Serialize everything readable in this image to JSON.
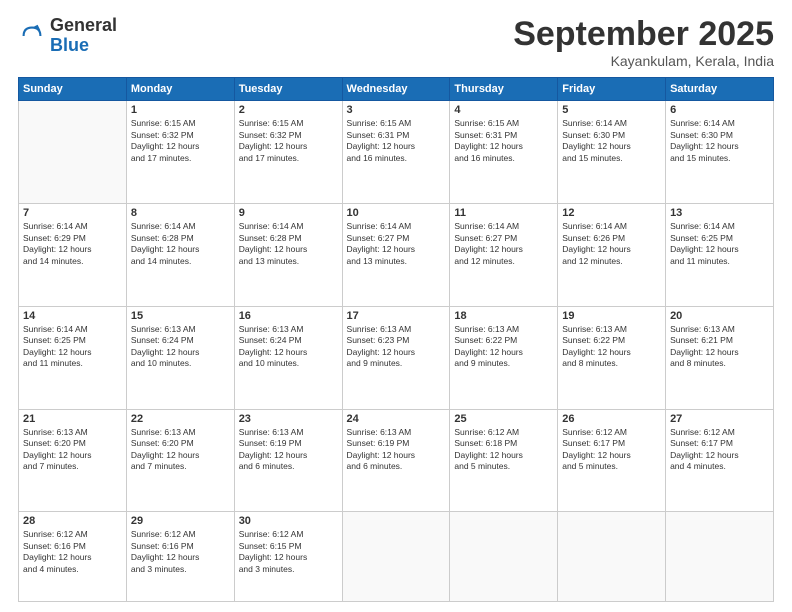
{
  "logo": {
    "general": "General",
    "blue": "Blue"
  },
  "header": {
    "month": "September 2025",
    "location": "Kayankulam, Kerala, India"
  },
  "weekdays": [
    "Sunday",
    "Monday",
    "Tuesday",
    "Wednesday",
    "Thursday",
    "Friday",
    "Saturday"
  ],
  "weeks": [
    [
      {
        "day": "",
        "info": ""
      },
      {
        "day": "1",
        "info": "Sunrise: 6:15 AM\nSunset: 6:32 PM\nDaylight: 12 hours\nand 17 minutes."
      },
      {
        "day": "2",
        "info": "Sunrise: 6:15 AM\nSunset: 6:32 PM\nDaylight: 12 hours\nand 17 minutes."
      },
      {
        "day": "3",
        "info": "Sunrise: 6:15 AM\nSunset: 6:31 PM\nDaylight: 12 hours\nand 16 minutes."
      },
      {
        "day": "4",
        "info": "Sunrise: 6:15 AM\nSunset: 6:31 PM\nDaylight: 12 hours\nand 16 minutes."
      },
      {
        "day": "5",
        "info": "Sunrise: 6:14 AM\nSunset: 6:30 PM\nDaylight: 12 hours\nand 15 minutes."
      },
      {
        "day": "6",
        "info": "Sunrise: 6:14 AM\nSunset: 6:30 PM\nDaylight: 12 hours\nand 15 minutes."
      }
    ],
    [
      {
        "day": "7",
        "info": "Sunrise: 6:14 AM\nSunset: 6:29 PM\nDaylight: 12 hours\nand 14 minutes."
      },
      {
        "day": "8",
        "info": "Sunrise: 6:14 AM\nSunset: 6:28 PM\nDaylight: 12 hours\nand 14 minutes."
      },
      {
        "day": "9",
        "info": "Sunrise: 6:14 AM\nSunset: 6:28 PM\nDaylight: 12 hours\nand 13 minutes."
      },
      {
        "day": "10",
        "info": "Sunrise: 6:14 AM\nSunset: 6:27 PM\nDaylight: 12 hours\nand 13 minutes."
      },
      {
        "day": "11",
        "info": "Sunrise: 6:14 AM\nSunset: 6:27 PM\nDaylight: 12 hours\nand 12 minutes."
      },
      {
        "day": "12",
        "info": "Sunrise: 6:14 AM\nSunset: 6:26 PM\nDaylight: 12 hours\nand 12 minutes."
      },
      {
        "day": "13",
        "info": "Sunrise: 6:14 AM\nSunset: 6:25 PM\nDaylight: 12 hours\nand 11 minutes."
      }
    ],
    [
      {
        "day": "14",
        "info": "Sunrise: 6:14 AM\nSunset: 6:25 PM\nDaylight: 12 hours\nand 11 minutes."
      },
      {
        "day": "15",
        "info": "Sunrise: 6:13 AM\nSunset: 6:24 PM\nDaylight: 12 hours\nand 10 minutes."
      },
      {
        "day": "16",
        "info": "Sunrise: 6:13 AM\nSunset: 6:24 PM\nDaylight: 12 hours\nand 10 minutes."
      },
      {
        "day": "17",
        "info": "Sunrise: 6:13 AM\nSunset: 6:23 PM\nDaylight: 12 hours\nand 9 minutes."
      },
      {
        "day": "18",
        "info": "Sunrise: 6:13 AM\nSunset: 6:22 PM\nDaylight: 12 hours\nand 9 minutes."
      },
      {
        "day": "19",
        "info": "Sunrise: 6:13 AM\nSunset: 6:22 PM\nDaylight: 12 hours\nand 8 minutes."
      },
      {
        "day": "20",
        "info": "Sunrise: 6:13 AM\nSunset: 6:21 PM\nDaylight: 12 hours\nand 8 minutes."
      }
    ],
    [
      {
        "day": "21",
        "info": "Sunrise: 6:13 AM\nSunset: 6:20 PM\nDaylight: 12 hours\nand 7 minutes."
      },
      {
        "day": "22",
        "info": "Sunrise: 6:13 AM\nSunset: 6:20 PM\nDaylight: 12 hours\nand 7 minutes."
      },
      {
        "day": "23",
        "info": "Sunrise: 6:13 AM\nSunset: 6:19 PM\nDaylight: 12 hours\nand 6 minutes."
      },
      {
        "day": "24",
        "info": "Sunrise: 6:13 AM\nSunset: 6:19 PM\nDaylight: 12 hours\nand 6 minutes."
      },
      {
        "day": "25",
        "info": "Sunrise: 6:12 AM\nSunset: 6:18 PM\nDaylight: 12 hours\nand 5 minutes."
      },
      {
        "day": "26",
        "info": "Sunrise: 6:12 AM\nSunset: 6:17 PM\nDaylight: 12 hours\nand 5 minutes."
      },
      {
        "day": "27",
        "info": "Sunrise: 6:12 AM\nSunset: 6:17 PM\nDaylight: 12 hours\nand 4 minutes."
      }
    ],
    [
      {
        "day": "28",
        "info": "Sunrise: 6:12 AM\nSunset: 6:16 PM\nDaylight: 12 hours\nand 4 minutes."
      },
      {
        "day": "29",
        "info": "Sunrise: 6:12 AM\nSunset: 6:16 PM\nDaylight: 12 hours\nand 3 minutes."
      },
      {
        "day": "30",
        "info": "Sunrise: 6:12 AM\nSunset: 6:15 PM\nDaylight: 12 hours\nand 3 minutes."
      },
      {
        "day": "",
        "info": ""
      },
      {
        "day": "",
        "info": ""
      },
      {
        "day": "",
        "info": ""
      },
      {
        "day": "",
        "info": ""
      }
    ]
  ]
}
